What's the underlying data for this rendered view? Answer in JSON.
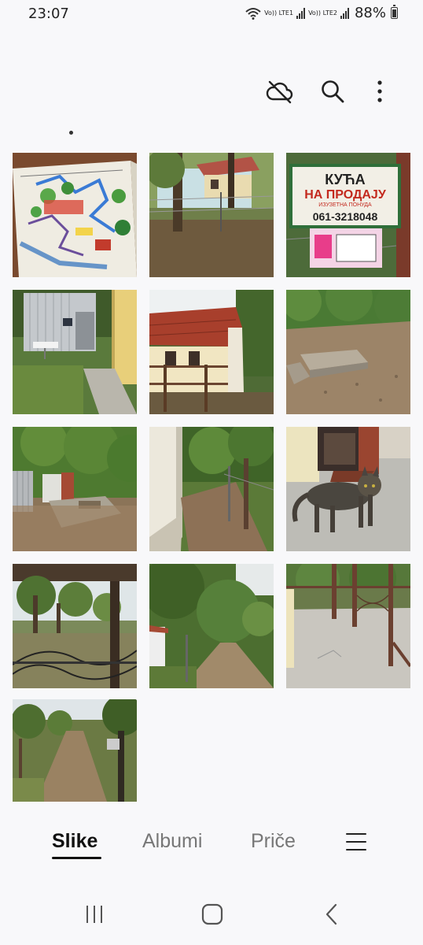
{
  "status_bar": {
    "time": "23:07",
    "sim1_label": "Vo)) LTE1",
    "sim2_label": "Vo)) LTE2",
    "battery_percent": "88%",
    "icons": [
      "wifi-icon",
      "signal-icon",
      "signal-icon",
      "battery-icon"
    ]
  },
  "toolbar": {
    "icons": [
      "cloud-off-icon",
      "search-icon",
      "more-options-icon"
    ]
  },
  "grid": {
    "items": [
      {
        "name": "photo-hand-drawn-map"
      },
      {
        "name": "photo-house-behind-fence"
      },
      {
        "name": "photo-for-sale-sign"
      },
      {
        "name": "photo-shed-and-yard"
      },
      {
        "name": "photo-red-roof-house"
      },
      {
        "name": "photo-garden-slab"
      },
      {
        "name": "photo-garden-shed"
      },
      {
        "name": "photo-house-side-path"
      },
      {
        "name": "photo-cat-on-porch"
      },
      {
        "name": "photo-porch-view-trees"
      },
      {
        "name": "photo-garden-path-trees"
      },
      {
        "name": "photo-terrace-railing"
      },
      {
        "name": "photo-dirt-road"
      }
    ],
    "sign_text": {
      "line1": "КУЋА",
      "line2": "НА ПРОДАЈУ",
      "line3": "ИЗУЗЕТНА ПОНУДА",
      "phone": "061-3218048"
    }
  },
  "tabs": [
    {
      "label": "Slike",
      "active": true
    },
    {
      "label": "Albumi",
      "active": false
    },
    {
      "label": "Priče",
      "active": false
    }
  ],
  "nav": {
    "icons": [
      "recent-apps-icon",
      "home-icon",
      "back-icon"
    ]
  },
  "colors": {
    "background": "#f8f8fa",
    "active_tab": "#111111",
    "inactive_tab": "#777777"
  }
}
